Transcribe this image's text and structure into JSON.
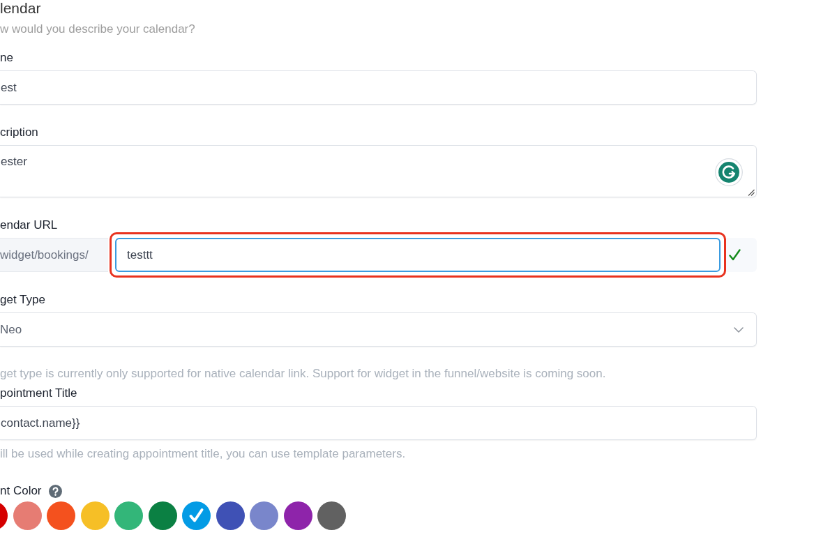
{
  "header": {
    "title": "lendar",
    "subtitle": "w would you describe your calendar?"
  },
  "fields": [
    {
      "kind": "text",
      "label": "ne",
      "value": "est"
    },
    {
      "kind": "textarea",
      "label": "cription",
      "value": "ester"
    },
    {
      "kind": "url",
      "label": "endar URL",
      "prefix": "widget/bookings/",
      "value": "testtt",
      "valid": true,
      "highlighted": true
    },
    {
      "kind": "select",
      "label": "get Type",
      "value": "Neo",
      "hint": "get type is currently only supported for native calendar link. Support for widget in the funnel/website is coming soon."
    },
    {
      "kind": "text",
      "label": "pointment Title",
      "value": "contact.name}}",
      "hint": "ill be used while creating appointment title, you can use template parameters."
    },
    {
      "kind": "color",
      "label": "nt Color",
      "help": true,
      "swatches": [
        {
          "color": "#d50000",
          "selected": false,
          "clipped": true
        },
        {
          "color": "#e67c73",
          "selected": false,
          "clipped": false
        },
        {
          "color": "#f4511e",
          "selected": false,
          "clipped": false
        },
        {
          "color": "#f6bf26",
          "selected": false,
          "clipped": false
        },
        {
          "color": "#33b679",
          "selected": false,
          "clipped": false
        },
        {
          "color": "#0b8043",
          "selected": false,
          "clipped": false
        },
        {
          "color": "#039be5",
          "selected": true,
          "clipped": false
        },
        {
          "color": "#3f51b5",
          "selected": false,
          "clipped": false
        },
        {
          "color": "#7986cb",
          "selected": false,
          "clipped": false
        },
        {
          "color": "#8e24aa",
          "selected": false,
          "clipped": false
        },
        {
          "color": "#616161",
          "selected": false,
          "clipped": false
        }
      ]
    }
  ]
}
